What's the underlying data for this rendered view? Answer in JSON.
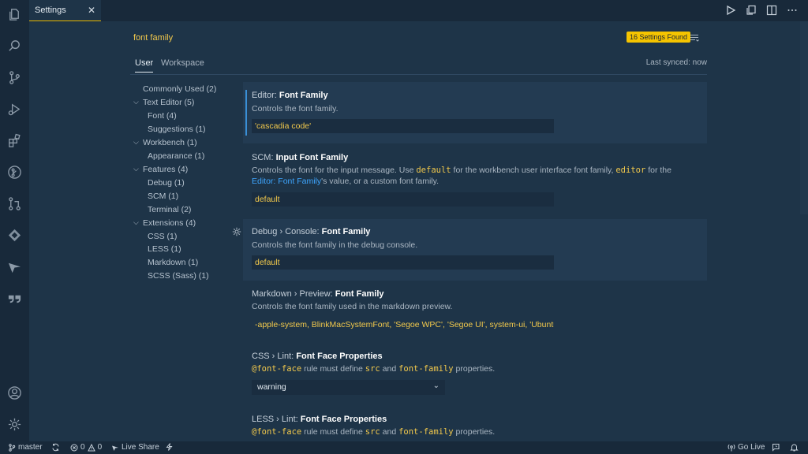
{
  "tab": {
    "title": "Settings",
    "close": "✕"
  },
  "search": {
    "query": "font family",
    "found": "16 Settings Found"
  },
  "scope": {
    "user": "User",
    "workspace": "Workspace",
    "last_synced": "Last synced: now"
  },
  "toc": [
    {
      "label": "Commonly Used (2)"
    },
    {
      "label": "Text Editor (5)"
    },
    {
      "label": "Font (4)"
    },
    {
      "label": "Suggestions (1)"
    },
    {
      "label": "Workbench (1)"
    },
    {
      "label": "Appearance (1)"
    },
    {
      "label": "Features (4)"
    },
    {
      "label": "Debug (1)"
    },
    {
      "label": "SCM (1)"
    },
    {
      "label": "Terminal (2)"
    },
    {
      "label": "Extensions (4)"
    },
    {
      "label": "CSS (1)"
    },
    {
      "label": "LESS (1)"
    },
    {
      "label": "Markdown (1)"
    },
    {
      "label": "SCSS (Sass) (1)"
    }
  ],
  "settings": {
    "editor_font": {
      "prefix": "Editor: ",
      "name": "Font Family",
      "desc": "Controls the font family.",
      "value": "'cascadia code'"
    },
    "scm_font": {
      "prefix": "SCM: ",
      "name": "Input Font Family",
      "desc_1": "Controls the font for the input message. Use ",
      "code_1": "default",
      "desc_2": " for the workbench user interface font family, ",
      "code_2": "editor",
      "desc_3": " for the ",
      "link_1": "Editor:",
      "link_2": "Font Family",
      "desc_4": "'s value, or a custom font family.",
      "value": "default"
    },
    "debug_font": {
      "prefix": "Debug › Console: ",
      "name": "Font Family",
      "desc": "Controls the font family in the debug console.",
      "value": "default"
    },
    "markdown_font": {
      "prefix": "Markdown › Preview: ",
      "name": "Font Family",
      "desc": "Controls the font family used in the markdown preview.",
      "value": "-apple-system, BlinkMacSystemFont, 'Segoe WPC', 'Segoe UI', system-ui, 'Ubuntu'..."
    },
    "css_lint": {
      "prefix": "CSS › Lint: ",
      "name": "Font Face Properties",
      "code_1": "@font-face",
      "desc_1": " rule must define ",
      "code_2": "src",
      "desc_2": " and ",
      "code_3": "font-family",
      "desc_3": " properties.",
      "value": "warning"
    },
    "less_lint": {
      "prefix": "LESS › Lint: ",
      "name": "Font Face Properties",
      "code_1": "@font-face",
      "desc_1": " rule must define ",
      "code_2": "src",
      "desc_2": " and ",
      "code_3": "font-family",
      "desc_3": " properties."
    }
  },
  "status": {
    "branch": "master",
    "errors": "0",
    "warnings": "0",
    "live_share": "Live Share",
    "go_live": "Go Live"
  },
  "colors": {
    "accent": "#f5c400",
    "background": "#1e3448",
    "sidebar": "#18293a",
    "link": "#3ea6ff"
  }
}
